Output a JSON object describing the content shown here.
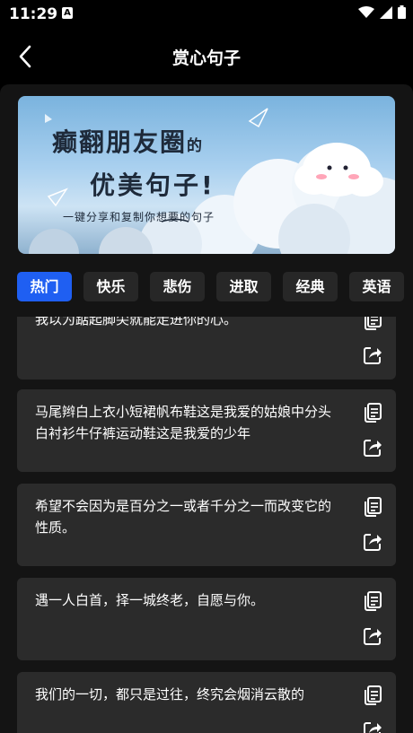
{
  "status": {
    "time": "11:29",
    "notif_letter": "A"
  },
  "header": {
    "title": "赏心句子"
  },
  "banner": {
    "line1_main": "癫翻朋友圈",
    "line1_small": "的",
    "line2": "优美句子!",
    "line3": "一键分享和复制你想要的句子"
  },
  "tabs": [
    {
      "label": "热门",
      "active": true
    },
    {
      "label": "快乐",
      "active": false
    },
    {
      "label": "悲伤",
      "active": false
    },
    {
      "label": "进取",
      "active": false
    },
    {
      "label": "经典",
      "active": false
    },
    {
      "label": "英语",
      "active": false
    }
  ],
  "sentences": [
    "我以为踮起脚尖就能走进你的心。",
    "马尾辫白上衣小短裙帆布鞋这是我爱的姑娘中分头白衬衫牛仔裤运动鞋这是我爱的少年",
    "希望不会因为是百分之一或者千分之一而改变它的性质。",
    "遇一人白首，择一城终老，自愿与你。",
    "我们的一切，都只是过往，终究会烟消云散的"
  ],
  "colors": {
    "accent": "#1f5ff2",
    "card": "#2b2b2b",
    "background": "#141414"
  }
}
